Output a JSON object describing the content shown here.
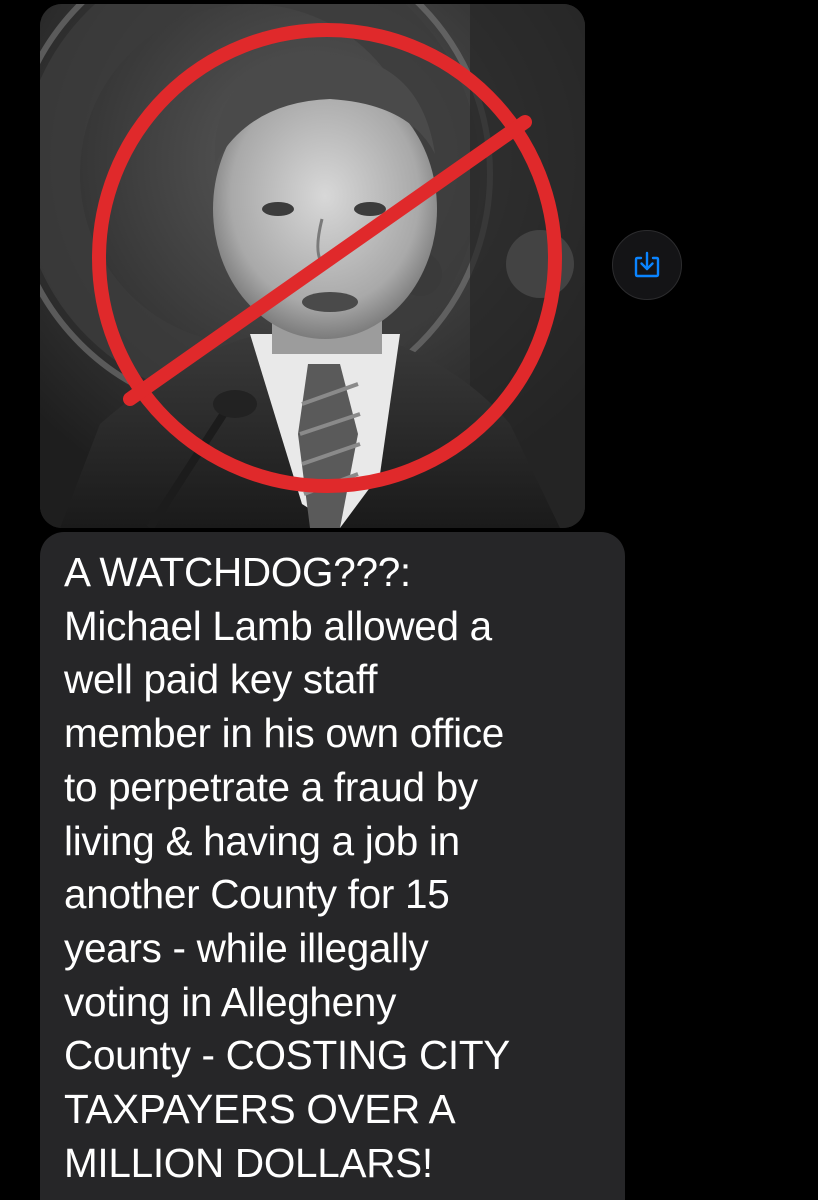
{
  "conversation": {
    "image_message": {
      "image_subject": "photo-of-man-crossed-out",
      "prohibition_color": "#e0292b"
    },
    "save_icon": "download-to-tray-icon",
    "accent_color": "#0a84ff",
    "text_message": {
      "body": "A WATCHDOG???:\nMichael Lamb allowed a\nwell paid key staff\nmember in his own office\nto perpetrate a fraud by\nliving & having a job in\nanother County for 15\nyears - while illegally\nvoting in Allegheny\nCounty - COSTING CITY\nTAXPAYERS OVER A\nMILLION DOLLARS!"
    }
  }
}
